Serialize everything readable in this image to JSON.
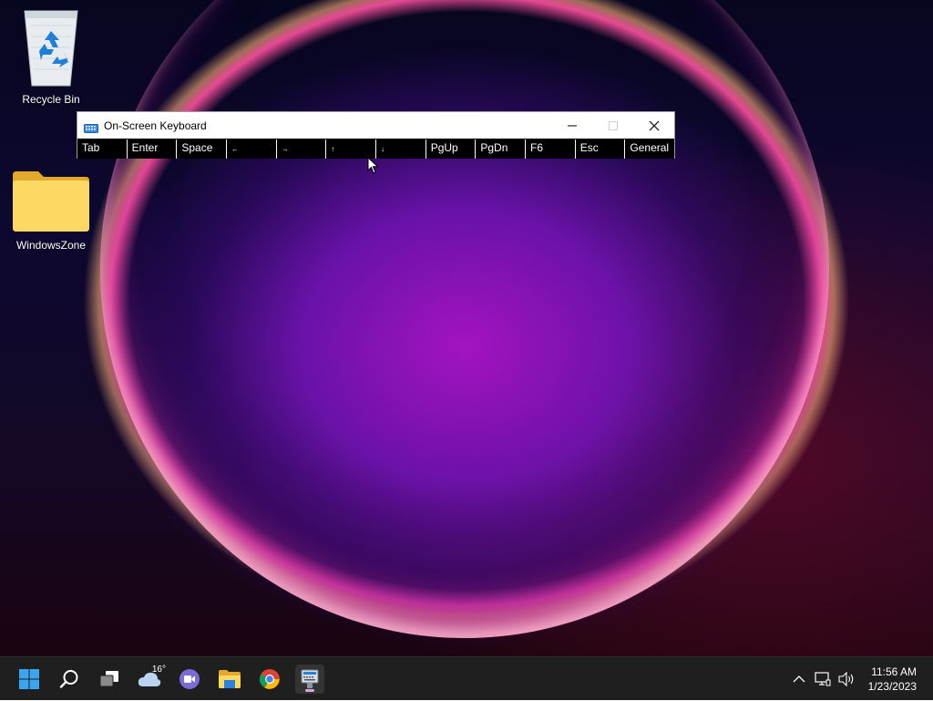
{
  "desktop": {
    "icons": [
      {
        "label": "Recycle Bin",
        "icon": "recycle-bin-icon"
      },
      {
        "label": "WindowsZone",
        "icon": "folder-icon"
      }
    ]
  },
  "window": {
    "title": "On-Screen Keyboard",
    "icon": "keyboard-icon",
    "keys": [
      "Tab",
      "Enter",
      "Space",
      "←",
      "→",
      "↑",
      "↓",
      "PgUp",
      "PgDn",
      "F6",
      "Esc",
      "General"
    ]
  },
  "taskbar": {
    "icons": [
      "windows-start-icon",
      "search-icon",
      "task-view-icon",
      "weather-icon",
      "teams-chat-icon",
      "file-explorer-icon",
      "chrome-icon",
      "on-screen-keyboard-icon"
    ],
    "weather_temp": "16°",
    "tray_icons": [
      "chevron-up-icon",
      "network-icon",
      "volume-icon"
    ],
    "time": "11:56 AM",
    "date": "1/23/2023"
  },
  "colors": {
    "taskbar_bg": "#1f1f1f",
    "keys_bg": "#000000",
    "accent_blue": "#0078d4"
  }
}
